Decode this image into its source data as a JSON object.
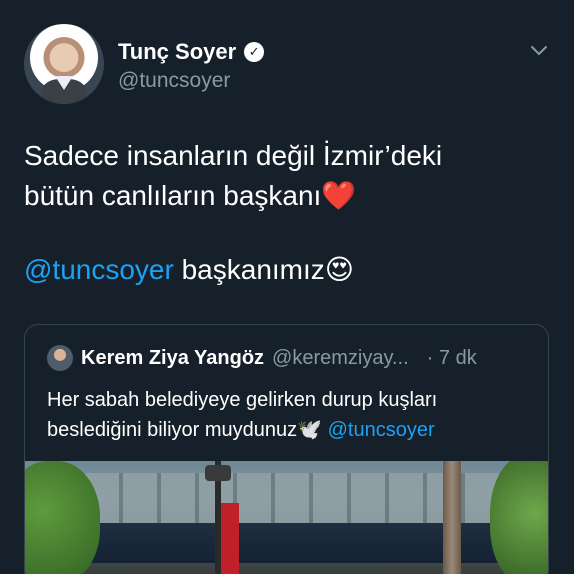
{
  "author": {
    "display_name": "Tunç Soyer",
    "handle": "@tuncsoyer",
    "verified": true
  },
  "tweet": {
    "line1": "Sadece insanların değil İzmir’deki",
    "line2": "bütün canlıların başkanı",
    "line2_emoji": "❤️",
    "mention": "@tuncsoyer",
    "line3_rest": " başkanımız",
    "line3_emoji": "😍"
  },
  "quoted_tweet": {
    "display_name": "Kerem Ziya Yangöz",
    "handle": "@keremziyay...",
    "time": "· 7 dk",
    "text_line1": "Her sabah belediyeye gelirken durup kuşları",
    "text_line2": "beslediğini biliyor muydunuz",
    "text_emoji": "🕊️",
    "text_mention": "@tuncsoyer"
  },
  "colors": {
    "background": "#15202b",
    "text": "#ffffff",
    "secondary_text": "#8899a6",
    "link": "#1da1f2",
    "card_border": "#38444d"
  },
  "icons": {
    "verified": "verified-badge-icon",
    "more": "chevron-down-icon"
  }
}
